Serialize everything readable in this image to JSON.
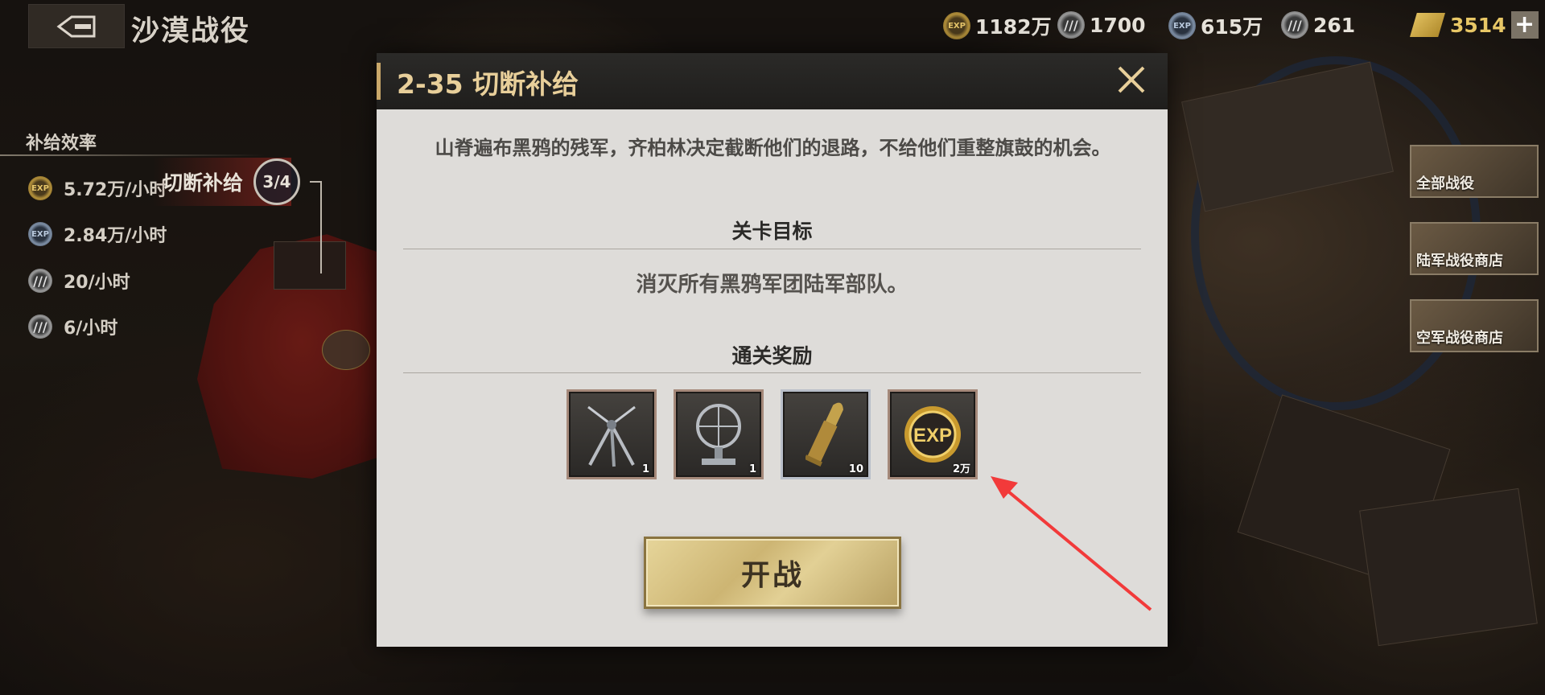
{
  "header": {
    "title": "沙漠战役",
    "resources": [
      {
        "icon": "exp-gold-icon",
        "badge": "EXP",
        "value": "1182万"
      },
      {
        "icon": "gold-stripe-icon",
        "badge": "///",
        "value": "1700"
      },
      {
        "icon": "exp-blue-icon",
        "badge": "EXP",
        "value": "615万"
      },
      {
        "icon": "silver-stripe-icon",
        "badge": "///",
        "value": "261"
      },
      {
        "icon": "gold-bars-icon",
        "value": "3514"
      }
    ],
    "plus_label": "+"
  },
  "supply": {
    "title": "补给效率",
    "rows": [
      {
        "icon": "exp-gold-icon",
        "badge": "EXP",
        "value": "5.72万/小时"
      },
      {
        "icon": "exp-blue-icon",
        "badge": "EXP",
        "value": "2.84万/小时"
      },
      {
        "icon": "gold-stripe-icon",
        "badge": "///",
        "value": "20/小时"
      },
      {
        "icon": "silver-stripe-icon",
        "badge": "///",
        "value": "6/小时"
      }
    ]
  },
  "map_stage": {
    "label": "切断补给",
    "progress": "3/4"
  },
  "side_menu": [
    {
      "label": "全部战役"
    },
    {
      "label": "陆军战役商店"
    },
    {
      "label": "空军战役商店"
    }
  ],
  "dialog": {
    "title": "2-35 切断补给",
    "description": "山脊遍布黑鸦的残军，齐柏林决定截断他们的退路，不给他们重整旗鼓的机会。",
    "objective_heading": "关卡目标",
    "objective_text": "消灭所有黑鸦军团陆军部队。",
    "reward_heading": "通关奖励",
    "rewards": [
      {
        "icon": "tripod-icon",
        "count": "1"
      },
      {
        "icon": "gun-sight-icon",
        "count": "1"
      },
      {
        "icon": "ammo-shell-icon",
        "count": "10"
      },
      {
        "icon": "exp-medal-icon",
        "badge": "EXP",
        "count": "2万"
      }
    ],
    "start_button": "开战"
  }
}
